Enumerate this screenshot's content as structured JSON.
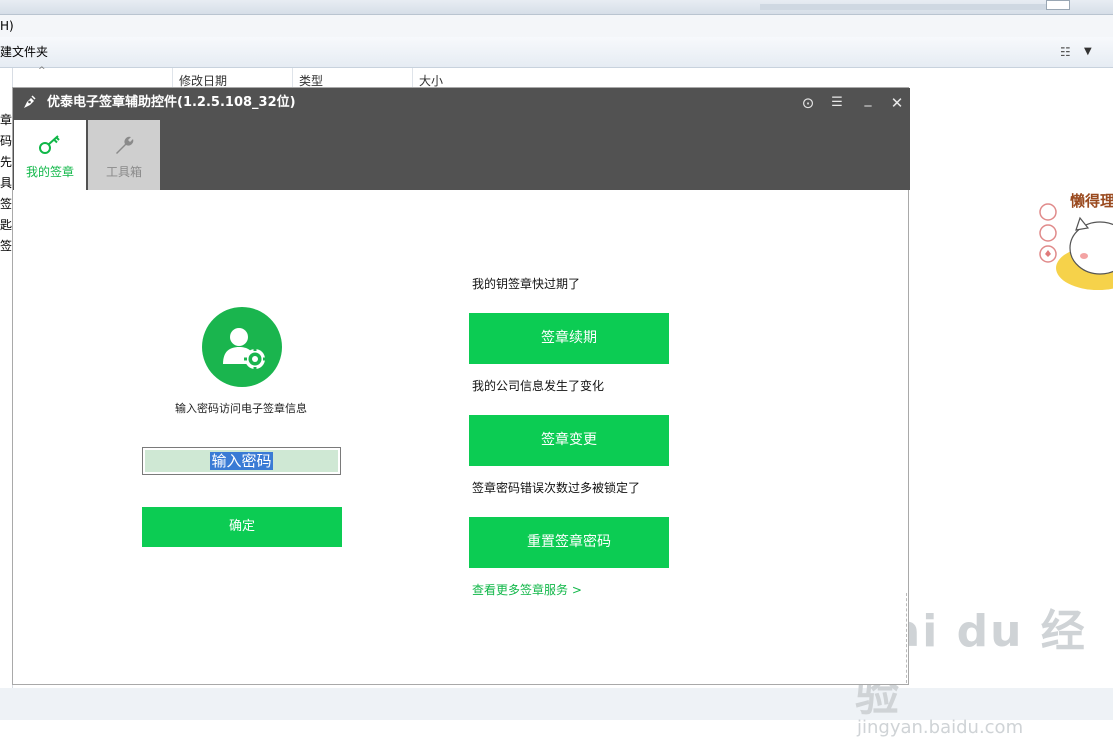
{
  "background": {
    "menu_fragment": "H)",
    "toolbar_fragment": "建文件夹",
    "left_items": [
      "章",
      "码",
      "先",
      "具",
      "签",
      "匙",
      "签"
    ],
    "columns": [
      "修改日期",
      "类型",
      "大小"
    ],
    "sticker_text": "懒得理"
  },
  "watermark": {
    "main": "Bai du 经验",
    "sub": "jingyan.baidu.com"
  },
  "dialog": {
    "title": "优泰电子签章辅助控件(1.2.5.108_32位)",
    "controls": {
      "user": "⊙",
      "menu": "☰",
      "minimize": "_",
      "close": "✕"
    },
    "tabs": [
      {
        "label": "我的签章",
        "icon": "key-icon",
        "active": true
      },
      {
        "label": "工具箱",
        "icon": "wrench-icon",
        "active": false
      }
    ],
    "login": {
      "hint": "输入密码访问电子签章信息",
      "password_value": "输入密码",
      "confirm_label": "确定"
    },
    "services": [
      {
        "prompt": "我的钥签章快过期了",
        "button": "签章续期"
      },
      {
        "prompt": "我的公司信息发生了变化",
        "button": "签章变更"
      },
      {
        "prompt": "签章密码错误次数过多被锁定了",
        "button": "重置签章密码"
      }
    ],
    "more_link": "查看更多签章服务 >"
  },
  "colors": {
    "titlebar": "#525252",
    "accent_green": "#0ccc53",
    "tab_active_text": "#10b748"
  }
}
